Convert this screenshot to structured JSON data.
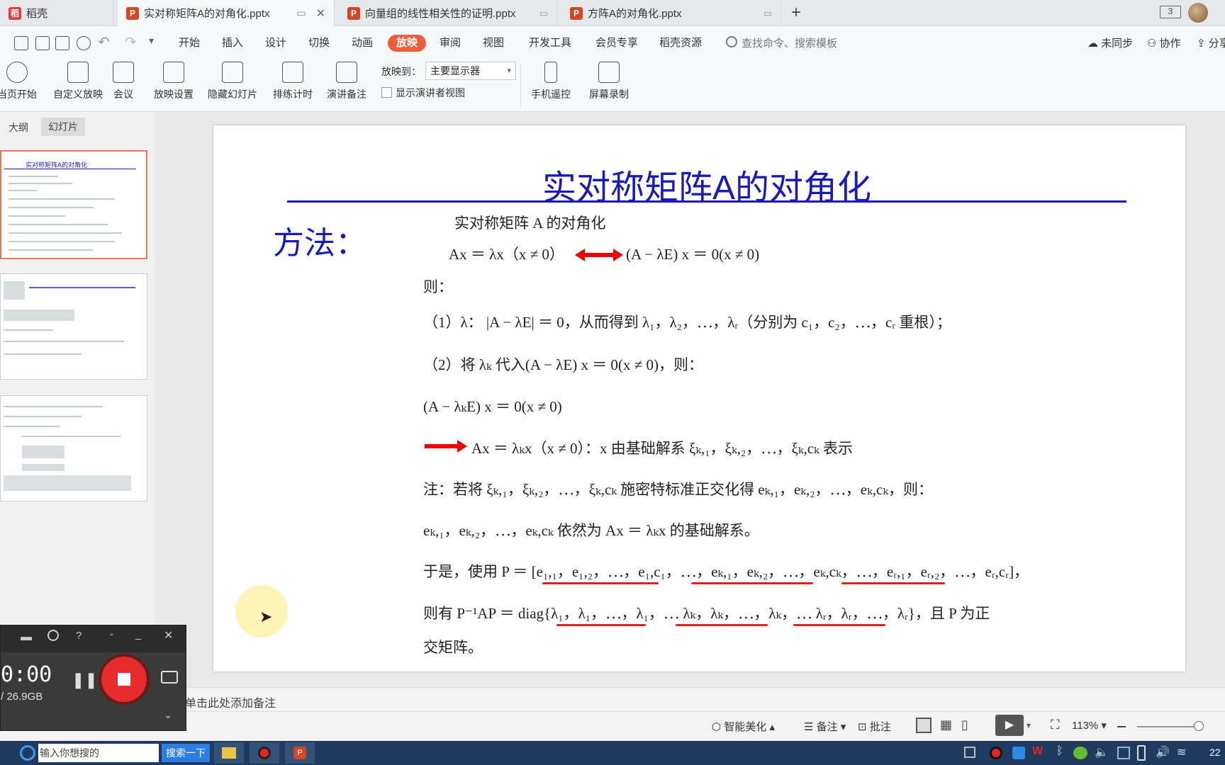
{
  "tabs": [
    {
      "label": "稻壳",
      "icon": "docer-icon"
    },
    {
      "label": "实对称矩阵A的对角化.pptx",
      "icon": "ppt-icon"
    },
    {
      "label": "向量组的线性相关性的证明.pptx",
      "icon": "ppt-icon"
    },
    {
      "label": "方阵A的对角化.pptx",
      "icon": "ppt-icon"
    }
  ],
  "tab_add": "+",
  "tab_badge": "3",
  "menu": [
    "开始",
    "插入",
    "设计",
    "切换",
    "动画",
    "放映",
    "审阅",
    "视图",
    "开发工具",
    "会员专享",
    "稻壳资源"
  ],
  "menu_active": "放映",
  "search_placeholder": "查找命令、搜索模板",
  "sync": "未同步",
  "collab": "协作",
  "share": "分享",
  "ribbon": {
    "from_current": "当页开始",
    "custom": "自定义放映",
    "meeting": "会议",
    "settings": "放映设置",
    "hide": "隐藏幻灯片",
    "rehearse": "排练计时",
    "notes": "演讲备注",
    "show_on_label": "放映到：",
    "show_on_value": "主要显示器",
    "presenter_view": "显示演讲者视图",
    "remote": "手机遥控",
    "record": "屏幕录制"
  },
  "panel_tabs": [
    "大纲",
    "幻灯片"
  ],
  "thumb1_title": "实对称矩阵A的对角化",
  "slide": {
    "title": "实对称矩阵A的对角化",
    "method": "方法：",
    "l1": "实对称矩阵 A 的对角化",
    "l2a": "Ax ＝ λx（x ≠ 0）",
    "l2b": "(A − λE) x ＝ 0(x ≠ 0)",
    "l3": "则：",
    "l4": "（1）λ： |A − λE| ＝ 0，从而得到 λ₁，λ₂，⋯，λᵣ（分别为 c₁，c₂，⋯，cᵣ 重根）；",
    "l5": "（2）将 λₖ 代入(A − λE) x ＝ 0(x ≠ 0)，则：",
    "l6": "(A − λₖE) x ＝ 0(x ≠ 0)",
    "l7": "Ax ＝ λₖx（x ≠ 0）：x 由基础解系 ξₖ,₁，ξₖ,₂，⋯，ξₖ,cₖ 表示",
    "l8": "注：若将 ξₖ,₁，ξₖ,₂，⋯，ξₖ,cₖ 施密特标准正交化得 eₖ,₁，eₖ,₂，⋯，eₖ,cₖ，则：",
    "l9": "eₖ,₁，eₖ,₂，⋯，eₖ,cₖ 依然为 Ax ＝ λₖx 的基础解系。",
    "l10": "于是，使用 P ＝ [e₁,₁，e₁,₂，⋯，e₁,c₁，⋯，eₖ,₁，eₖ,₂，⋯，eₖ,cₖ，⋯，eᵣ,₁，eᵣ,₂，⋯，eᵣ,cᵣ]，",
    "l11": "则有 P⁻¹AP ＝ diag{λ₁，λ₁，⋯，λ₁，⋯ λₖ，λₖ，⋯，λₖ，⋯ λᵣ，λᵣ，⋯，λᵣ}，且 P 为正",
    "l12": "交矩阵。"
  },
  "notes_placeholder": "单击此处添加备注",
  "status": {
    "beautify": "智能美化",
    "notes": "备注",
    "comment": "批注",
    "zoom": "113%"
  },
  "recorder": {
    "time": "0:00",
    "size": "/ 26.9GB"
  },
  "taskbar": {
    "search": "输入你想搜的",
    "search_btn": "搜索一下",
    "clock": "22"
  },
  "colors": {
    "title_blue": "#1a1ab8",
    "accent": "#ea5f3a",
    "red": "#e00000"
  }
}
